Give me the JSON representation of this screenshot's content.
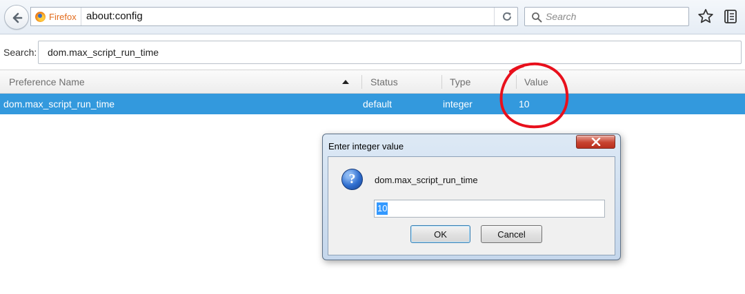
{
  "toolbar": {
    "identity_label": "Firefox",
    "url": "about:config",
    "search_placeholder": "Search"
  },
  "config": {
    "search_label": "Search:",
    "search_value": "dom.max_script_run_time",
    "columns": {
      "name": "Preference Name",
      "status": "Status",
      "type": "Type",
      "value": "Value"
    },
    "sort_column": "name",
    "sort_direction": "ascending",
    "rows": [
      {
        "name": "dom.max_script_run_time",
        "status": "default",
        "type": "integer",
        "value": "10",
        "selected": true
      }
    ]
  },
  "dialog": {
    "title": "Enter integer value",
    "message": "dom.max_script_run_time",
    "input_value": "10",
    "ok_label": "OK",
    "cancel_label": "Cancel",
    "icon": "question-icon"
  },
  "icons": {
    "back": "back-arrow-icon",
    "identity": "firefox-icon",
    "reload": "reload-icon",
    "search": "search-icon",
    "bookmark": "star-icon",
    "menu": "hamburger-menu-icon",
    "close": "close-icon",
    "sort": "sort-ascending-icon"
  },
  "colors": {
    "selection": "#3399dd",
    "annotation": "#e8101c",
    "dialog_frame": "#c5d7ec",
    "close_button": "#c8432f"
  }
}
